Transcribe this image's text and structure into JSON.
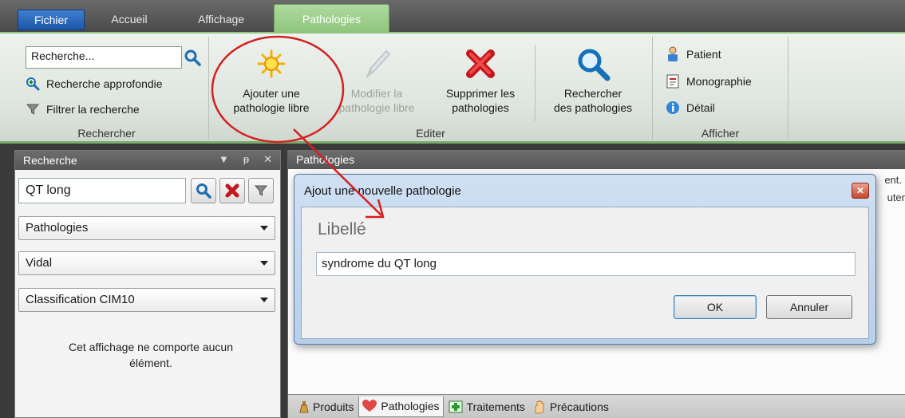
{
  "tabs": {
    "fichier": "Fichier",
    "accueil": "Accueil",
    "affichage": "Affichage",
    "pathologies": "Pathologies"
  },
  "ribbon": {
    "rechercher": {
      "label": "Rechercher",
      "search_value": "Recherche...",
      "advanced": "Recherche approfondie",
      "filter": "Filtrer la recherche"
    },
    "editer": {
      "label": "Editer",
      "add_line1": "Ajouter une",
      "add_line2": "pathologie libre",
      "modify_line1": "Modifier la",
      "modify_line2": "pathologie libre",
      "delete_line1": "Supprimer les",
      "delete_line2": "pathologies",
      "search_line1": "Rechercher",
      "search_line2": "des pathologies"
    },
    "afficher": {
      "label": "Afficher",
      "patient": "Patient",
      "monographie": "Monographie",
      "detail": "Détail"
    }
  },
  "left_pane": {
    "title": "Recherche",
    "search_value": "QT long",
    "combo1": "Pathologies",
    "combo2": "Vidal",
    "combo3": "Classification CIM10",
    "empty_line1": "Cet affichage ne comporte aucun",
    "empty_line2": "élément."
  },
  "right_pane": {
    "title": "Pathologies",
    "bg_text_1": "ent.",
    "bg_text_2": "uter"
  },
  "bottom_tabs": {
    "produits": "Produits",
    "pathologies": "Pathologies",
    "traitements": "Traitements",
    "precautions": "Précautions"
  },
  "dialog": {
    "title": "Ajout une nouvelle pathologie",
    "field_label": "Libellé",
    "field_value": "syndrome du QT long",
    "ok": "OK",
    "cancel": "Annuler"
  },
  "colors": {
    "ribbon_accent": "#8fc47c",
    "annotation": "#d42020",
    "fichier_tab": "#1c56a8"
  }
}
